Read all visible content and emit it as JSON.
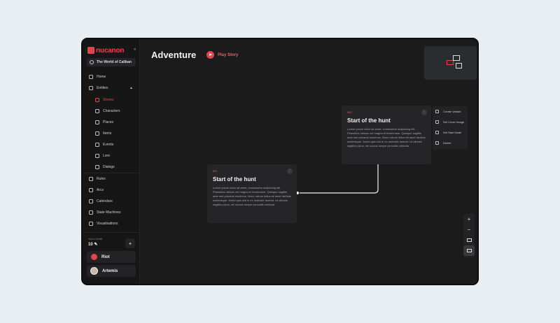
{
  "app": {
    "logo": "nucanon",
    "world": "The World of Caliban"
  },
  "sidebar": {
    "items": [
      {
        "label": "Home",
        "icon": "home-icon"
      },
      {
        "label": "Entities",
        "icon": "entities-icon"
      }
    ],
    "sub_items": [
      {
        "label": "Stories",
        "icon": "book-icon",
        "active": true
      },
      {
        "label": "Characters",
        "icon": "person-icon"
      },
      {
        "label": "Places",
        "icon": "map-icon"
      },
      {
        "label": "Items",
        "icon": "cube-icon"
      },
      {
        "label": "Events",
        "icon": "calendar-icon"
      },
      {
        "label": "Lore",
        "icon": "lore-icon"
      },
      {
        "label": "Dialogs",
        "icon": "chat-icon"
      }
    ],
    "bottom_items": [
      {
        "label": "Rules",
        "icon": "rules-icon"
      },
      {
        "label": "Arcs",
        "icon": "arcs-icon"
      },
      {
        "label": "Calendars",
        "icon": "calendar-icon"
      },
      {
        "label": "State Machines",
        "icon": "state-icon"
      },
      {
        "label": "Visualisations",
        "icon": "chart-icon"
      }
    ],
    "credit": {
      "label": "Your Credit",
      "value": "10 ✎",
      "add": "+"
    },
    "team": "Riot",
    "user": "Artemis"
  },
  "main": {
    "title": "Adventure",
    "play_label": "Play Story",
    "cards": [
      {
        "tag": "001",
        "title": "Start of the hunt",
        "body": "Lorem ipsum dolor sit amet, consectetur adipiscing elit. Phasellus ultrices vel magna et fermentum. Quisque sagittis ante sed placerat maximus. Nunc rutrum tellus sit amet facilisis scelerisque. Morbi quis nisl in ex molestie laoreet. Ut ultrices sagittis purus, vel cursus neque convallis vehicula."
      },
      {
        "tag": "002",
        "title": "Start of the hunt",
        "body": "Lorem ipsum dolor sit amet, consectetur adipiscing elit. Phasellus ultrices vel magna et fermentum. Quisque sagittis ante sed placerat maximus. Nunc rutrum tellus sit amet facilisis scelerisque. Morbi quis nisl in ex molestie laoreet. Ut ultrices sagittis purus, vel cursus neque convallis vehicula."
      }
    ],
    "context_menu": [
      {
        "label": "Create Variant",
        "icon": "branch-icon"
      },
      {
        "label": "Set Cover Image",
        "icon": "image-icon"
      },
      {
        "label": "Set Start Node",
        "icon": "play-icon"
      },
      {
        "label": "Delete",
        "icon": "trash-icon"
      }
    ],
    "zoom": {
      "in": "+",
      "out": "−"
    }
  },
  "colors": {
    "accent": "#e0474c",
    "background": "#1b1b1c",
    "sidebar": "#161617",
    "card": "#252527"
  }
}
